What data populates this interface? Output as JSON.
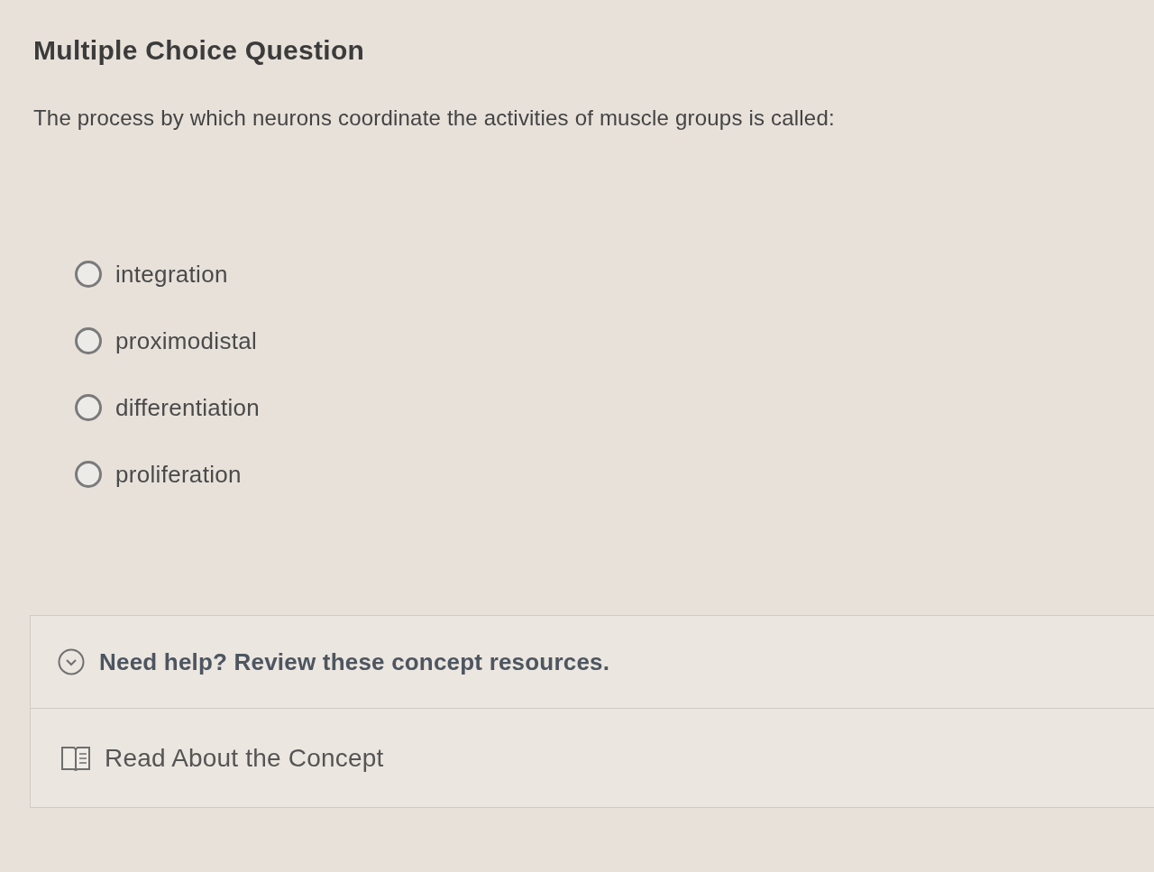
{
  "question": {
    "type_label": "Multiple Choice Question",
    "prompt": "The process by which neurons coordinate the activities of muscle groups is called:",
    "options": [
      {
        "label": "integration",
        "selected": false
      },
      {
        "label": "proximodistal",
        "selected": false
      },
      {
        "label": "differentiation",
        "selected": false
      },
      {
        "label": "proliferation",
        "selected": false
      }
    ]
  },
  "help": {
    "title": "Need help? Review these concept resources.",
    "expanded": true,
    "resources": [
      {
        "label": "Read About the Concept"
      }
    ]
  }
}
